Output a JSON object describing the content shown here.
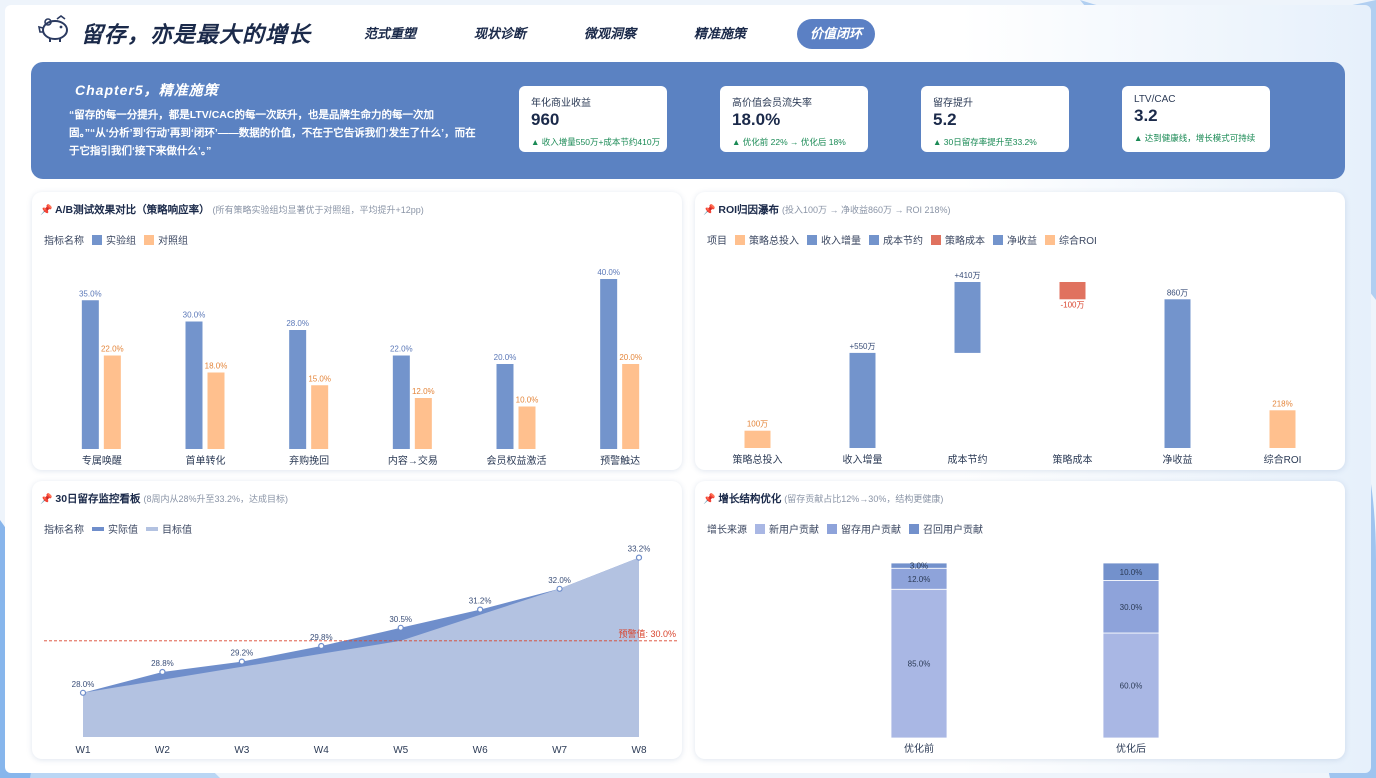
{
  "header": {
    "title": "留存，亦是最大的增长",
    "nav": [
      "范式重塑",
      "现状诊断",
      "微观洞察",
      "精准施策",
      "价值闭环"
    ],
    "active_nav": 4
  },
  "hero": {
    "chapter": "Chapter5，精准施策",
    "quote": "“留存的每一分提升，都是LTV/CAC的每一次跃升，也是品牌生命力的每一次加固。”“从‘分析’到‘行动’再到‘闭环’——数据的价值，不在于它告诉我们‘发生了什么’，而在于它指引我们‘接下来做什么’。”",
    "kpis": [
      {
        "label": "年化商业收益",
        "value": "960",
        "sub": "▲ 收入增量550万+成本节约410万"
      },
      {
        "label": "高价值会员流失率",
        "value": "18.0%",
        "sub": "▲ 优化前 22% → 优化后 18%"
      },
      {
        "label": "留存提升",
        "value": "5.2",
        "sub": "▲ 30日留存率提升至33.2%"
      },
      {
        "label": "LTV/CAC",
        "value": "3.2",
        "sub": "▲ 达到健康线，增长模式可持续"
      }
    ]
  },
  "panels": {
    "ab": {
      "title": "A/B测试效果对比（策略响应率）",
      "sub": "(所有策略实验组均显著优于对照组，平均提升+12pp)"
    },
    "roi": {
      "title": "ROI归因瀑布",
      "sub": "(投入100万 → 净收益860万 → ROI 218%)"
    },
    "retention": {
      "title": "30日留存监控看板",
      "sub": "(8周内从28%升至33.2%，达成目标)"
    },
    "growth": {
      "title": "增长结构优化",
      "sub": "(留存贡献占比12%→30%，结构更健康)"
    }
  },
  "chart_data": [
    {
      "type": "bar",
      "legend_title": "指标名称",
      "categories": [
        "专属唤醒",
        "首单转化",
        "弃购挽回",
        "内容→交易",
        "会员权益激活",
        "预警触达"
      ],
      "series": [
        {
          "name": "实验组",
          "values": [
            35.0,
            30.0,
            28.0,
            22.0,
            20.0,
            40.0
          ],
          "color": "#7394cc",
          "label_color": "#5b78b8"
        },
        {
          "name": "对照组",
          "values": [
            22.0,
            18.0,
            15.0,
            12.0,
            10.0,
            20.0
          ],
          "color": "#ffc08e",
          "label_color": "#e4853a"
        }
      ],
      "ylim": [
        0,
        40
      ]
    },
    {
      "type": "bar",
      "legend_title": "项目",
      "legend": [
        {
          "name": "策略总投入",
          "color": "#ffc08e"
        },
        {
          "name": "收入增量",
          "color": "#7394cc"
        },
        {
          "name": "成本节约",
          "color": "#7394cc"
        },
        {
          "name": "策略成本",
          "color": "#e0725f"
        },
        {
          "name": "净收益",
          "color": "#7394cc"
        },
        {
          "name": "综合ROI",
          "color": "#ffc08e"
        }
      ],
      "categories": [
        "策略总投入",
        "收入增量",
        "成本节约",
        "策略成本",
        "净收益",
        "综合ROI"
      ],
      "bars": [
        {
          "base": 0,
          "top": 100,
          "label": "100万",
          "color": "#ffc08e",
          "label_color": "#e4853a"
        },
        {
          "base": 0,
          "top": 550,
          "label": "+550万",
          "color": "#7394cc",
          "label_color": "#3a4e78"
        },
        {
          "base": 550,
          "top": 960,
          "label": "+410万",
          "color": "#7394cc",
          "label_color": "#3a4e78"
        },
        {
          "base": 860,
          "top": 960,
          "label": "-100万",
          "color": "#e0725f",
          "label_color": "#d9452e",
          "label_below": true
        },
        {
          "base": 0,
          "top": 860,
          "label": "860万",
          "color": "#7394cc",
          "label_color": "#3a4e78"
        },
        {
          "base": 0,
          "top": 218,
          "label": "218%",
          "color": "#ffc08e",
          "label_color": "#e4853a"
        }
      ],
      "ylim": [
        0,
        960
      ]
    },
    {
      "type": "area",
      "legend_title": "指标名称",
      "x": [
        "W1",
        "W2",
        "W3",
        "W4",
        "W5",
        "W6",
        "W7",
        "W8"
      ],
      "series": [
        {
          "name": "实际值",
          "values": [
            28.0,
            28.8,
            29.2,
            29.8,
            30.5,
            31.2,
            32.0,
            33.2
          ],
          "color": "#6f8ecb"
        },
        {
          "name": "目标值",
          "values": [
            28.0,
            28.5,
            29.0,
            29.5,
            30.0,
            31.0,
            32.0,
            33.2
          ],
          "color": "#b3c2e1"
        }
      ],
      "threshold": {
        "value": 30.0,
        "label": "预警值: 30.0%",
        "color": "#d9452e"
      },
      "ylim": [
        26.3,
        33.3
      ]
    },
    {
      "type": "bar",
      "stacked": true,
      "legend_title": "增长来源",
      "categories": [
        "优化前",
        "优化后"
      ],
      "series": [
        {
          "name": "新用户贡献",
          "values": [
            85.0,
            60.0
          ],
          "color": "#a9b7e4"
        },
        {
          "name": "留存用户贡献",
          "values": [
            12.0,
            30.0
          ],
          "color": "#8ea3da"
        },
        {
          "name": "召回用户贡献",
          "values": [
            3.0,
            10.0
          ],
          "color": "#7391cc"
        }
      ],
      "ylim": [
        0,
        100
      ]
    }
  ]
}
